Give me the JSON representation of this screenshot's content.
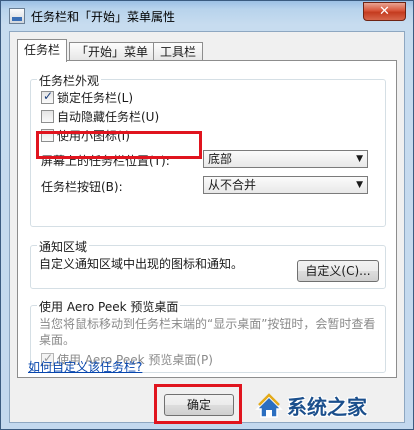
{
  "window": {
    "title": "任务栏和「开始」菜单属性",
    "close_glyph": "✕"
  },
  "tabs": [
    {
      "label": "任务栏",
      "active": true
    },
    {
      "label": "「开始」菜单",
      "active": false
    },
    {
      "label": "工具栏",
      "active": false
    }
  ],
  "appearance": {
    "group_label": "任务栏外观",
    "lock_taskbar": {
      "label": "锁定任务栏(L)",
      "checked": true
    },
    "auto_hide": {
      "label": "自动隐藏任务栏(U)",
      "checked": false
    },
    "small_icons": {
      "label": "使用小图标(I)",
      "checked": false
    },
    "location_label": "屏幕上的任务栏位置(T):",
    "location_value": "底部",
    "buttons_label": "任务栏按钮(B):",
    "buttons_value": "从不合并"
  },
  "notification": {
    "group_label": "通知区域",
    "description": "自定义通知区域中出现的图标和通知。",
    "customize_button": "自定义(C)..."
  },
  "aero_peek": {
    "group_label": "使用 Aero Peek 预览桌面",
    "description": "当您将鼠标移动到任务栏末端的“显示桌面”按钮时，会暂时查看桌面。",
    "checkbox": {
      "label": "使用 Aero Peek 预览桌面(P)",
      "checked": true,
      "disabled": true
    }
  },
  "help_link": "如何自定义该任务栏?",
  "ok_button": "确定",
  "watermark": {
    "text": "系统之家"
  },
  "colors": {
    "highlight": "#e0141e",
    "link": "#0645ad"
  }
}
